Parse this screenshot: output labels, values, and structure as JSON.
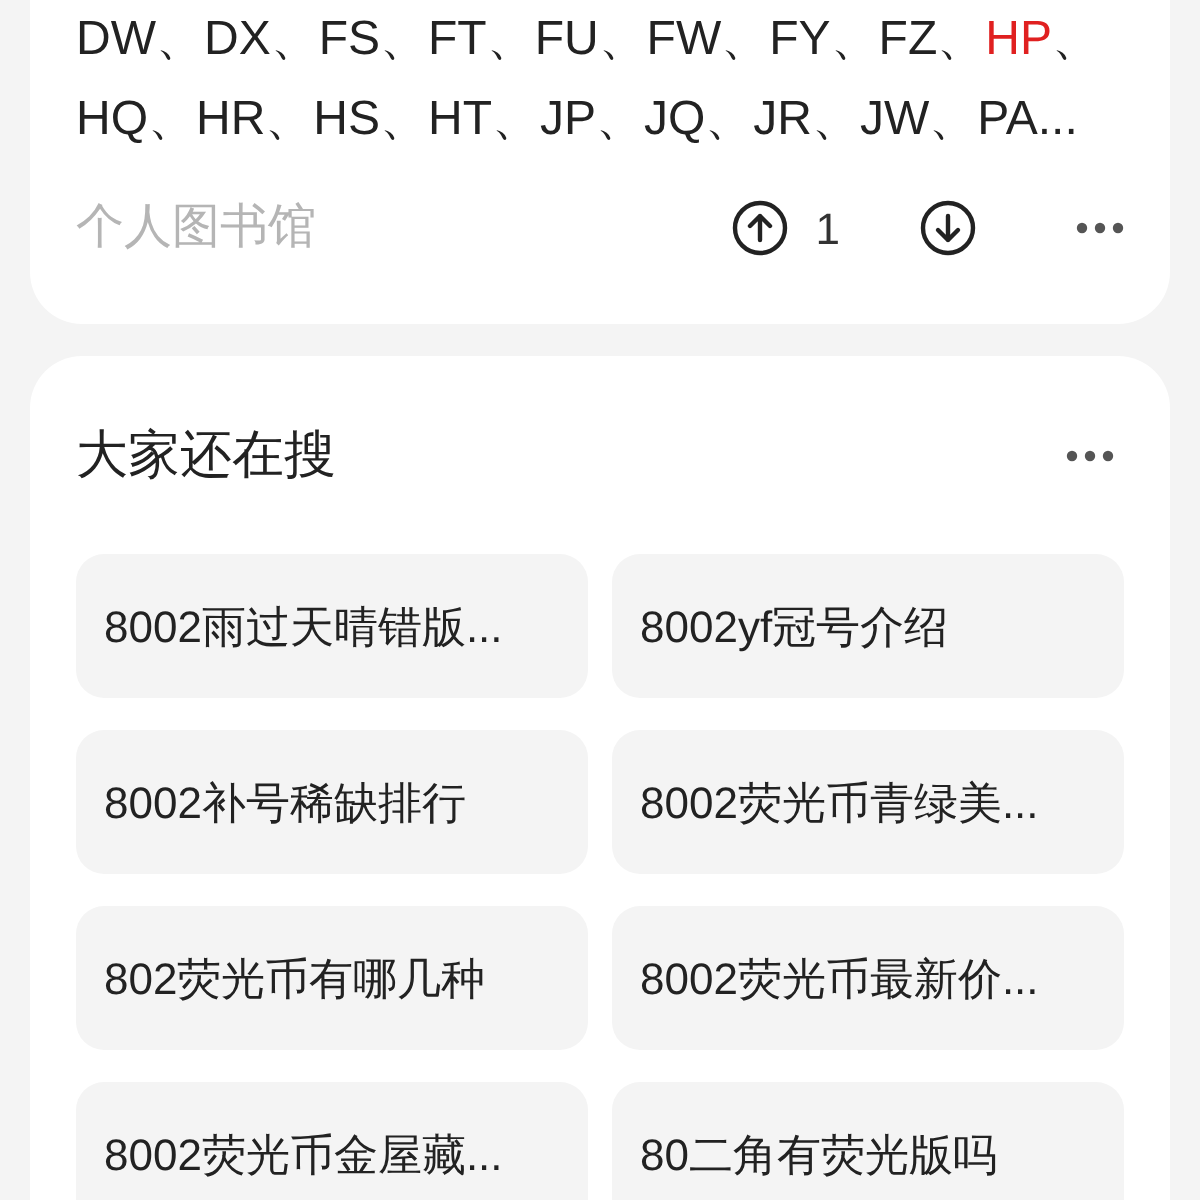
{
  "article": {
    "tags_line_1": [
      {
        "text": "DW、DX、FS、FT、FU、FW、FY、FZ、",
        "highlight": false
      },
      {
        "text": "HP",
        "highlight": true
      },
      {
        "text": "、",
        "highlight": false
      }
    ],
    "tags_line_2": "HQ、HR、HS、HT、JP、JQ、JR、JW、PA...",
    "source": "个人图书馆",
    "upvotes": "1"
  },
  "related_searches": {
    "title": "大家还在搜",
    "items": [
      {
        "label": "8002雨过天晴错版..."
      },
      {
        "label": "8002yf冠号介绍"
      },
      {
        "label": "8002补号稀缺排行"
      },
      {
        "label": "8002荧光币青绿美..."
      },
      {
        "label": "802荧光币有哪几种"
      },
      {
        "label": "8002荧光币最新价..."
      },
      {
        "label": "8002荧光币金屋藏..."
      },
      {
        "label": "80二角有荧光版吗"
      }
    ]
  }
}
